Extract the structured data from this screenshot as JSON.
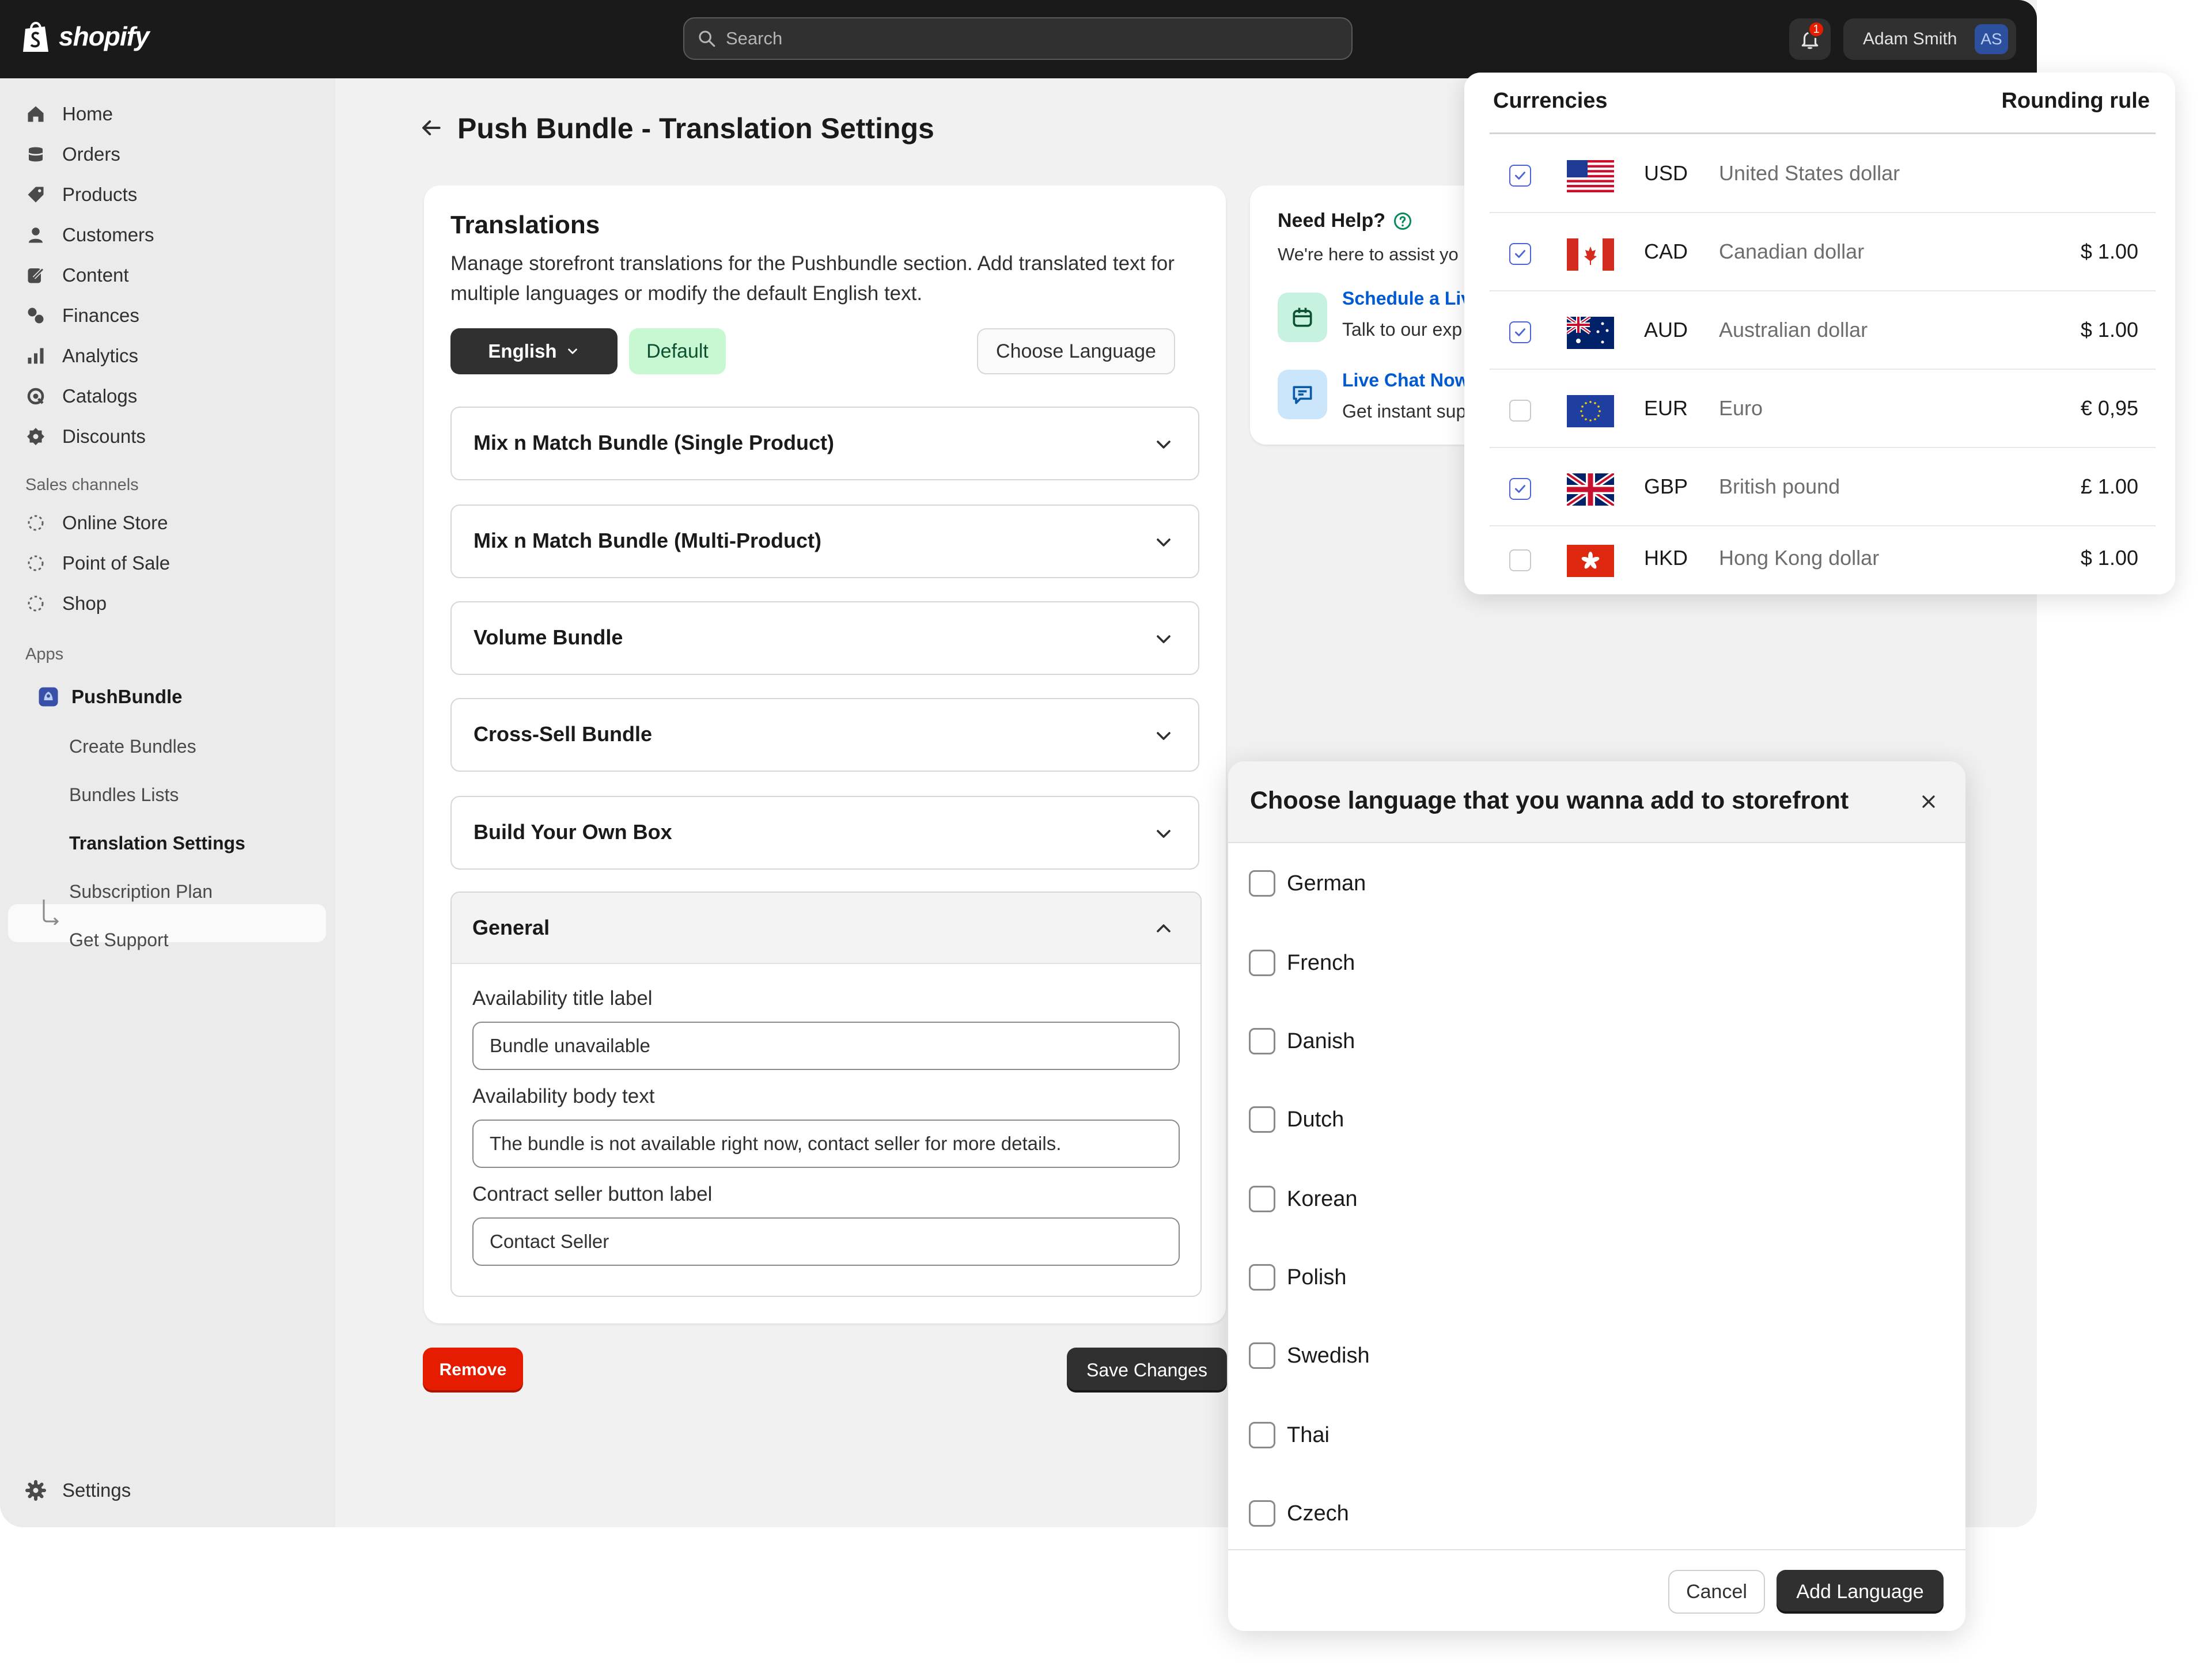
{
  "brand": {
    "name": "shopify"
  },
  "topbar": {
    "search_placeholder": "Search",
    "notification_count": "1",
    "user_name": "Adam Smith",
    "user_initials": "AS"
  },
  "sidebar": {
    "items": [
      {
        "label": "Home",
        "icon": "home-icon"
      },
      {
        "label": "Orders",
        "icon": "orders-icon"
      },
      {
        "label": "Products",
        "icon": "tag-icon"
      },
      {
        "label": "Customers",
        "icon": "person-icon"
      },
      {
        "label": "Content",
        "icon": "pencil-icon"
      },
      {
        "label": "Finances",
        "icon": "finance-icon"
      },
      {
        "label": "Analytics",
        "icon": "bar-chart-icon"
      },
      {
        "label": "Catalogs",
        "icon": "catalog-icon"
      },
      {
        "label": "Discounts",
        "icon": "discount-icon"
      }
    ],
    "sales_channels_label": "Sales channels",
    "sales_channels": [
      {
        "label": "Online Store"
      },
      {
        "label": "Point of Sale"
      },
      {
        "label": "Shop"
      }
    ],
    "apps_label": "Apps",
    "app_name": "PushBundle",
    "app_items": [
      {
        "label": "Create Bundles"
      },
      {
        "label": "Bundles Lists"
      },
      {
        "label": "Translation Settings",
        "active": true
      },
      {
        "label": "Subscription Plan"
      },
      {
        "label": "Get Support"
      }
    ],
    "settings_label": "Settings"
  },
  "main": {
    "page_title": "Push Bundle - Translation Settings",
    "card_title": "Translations",
    "card_description": "Manage storefront translations for the Pushbundle section. Add translated text for multiple languages or modify the default English text.",
    "language_button": "English",
    "default_badge": "Default",
    "choose_language_button": "Choose Language",
    "accordions": [
      "Mix n Match Bundle (Single Product)",
      "Mix n Match Bundle (Multi-Product)",
      "Volume Bundle",
      "Cross-Sell Bundle",
      "Build Your Own Box"
    ],
    "general": {
      "title": "General",
      "fields": [
        {
          "label": "Availability title label",
          "value": "Bundle unavailable"
        },
        {
          "label": "Availability body text",
          "value": "The bundle is not available right now, contact seller for more details."
        },
        {
          "label": "Contract seller button label",
          "value": "Contact Seller"
        }
      ]
    },
    "remove_button": "Remove",
    "save_button": "Save Changes"
  },
  "help": {
    "title": "Need Help?",
    "subtitle": "We're here to assist yo",
    "items": [
      {
        "link": "Schedule a Liv",
        "text": "Talk to our exp",
        "icon": "calendar-icon"
      },
      {
        "link": "Live Chat Now",
        "text": "Get instant sup",
        "icon": "chat-icon"
      }
    ]
  },
  "currencies": {
    "title": "Currencies",
    "rounding_header": "Rounding rule",
    "rows": [
      {
        "checked": true,
        "code": "USD",
        "name": "United States dollar",
        "amount": "",
        "flag": "us-flag-icon"
      },
      {
        "checked": true,
        "code": "CAD",
        "name": "Canadian dollar",
        "amount": "$ 1.00",
        "flag": "ca-flag-icon"
      },
      {
        "checked": true,
        "code": "AUD",
        "name": "Australian dollar",
        "amount": "$ 1.00",
        "flag": "au-flag-icon"
      },
      {
        "checked": false,
        "code": "EUR",
        "name": "Euro",
        "amount": "€ 0,95",
        "flag": "eu-flag-icon"
      },
      {
        "checked": true,
        "code": "GBP",
        "name": "British pound",
        "amount": "£ 1.00",
        "flag": "gb-flag-icon"
      },
      {
        "checked": false,
        "code": "HKD",
        "name": "Hong Kong dollar",
        "amount": "$ 1.00",
        "flag": "hk-flag-icon"
      }
    ]
  },
  "language_modal": {
    "title": "Choose language that you wanna add to storefront",
    "options": [
      "German",
      "French",
      "Danish",
      "Dutch",
      "Korean",
      "Polish",
      "Swedish",
      "Thai",
      "Czech"
    ],
    "cancel_button": "Cancel",
    "add_button": "Add Language"
  },
  "colors": {
    "topbar": "#1a1a1a",
    "primary_button": "#303030",
    "critical": "#e51c00",
    "success_badge": "#c8f8d2",
    "link": "#005bd3",
    "checkbox_accent": "#4a64d8"
  }
}
